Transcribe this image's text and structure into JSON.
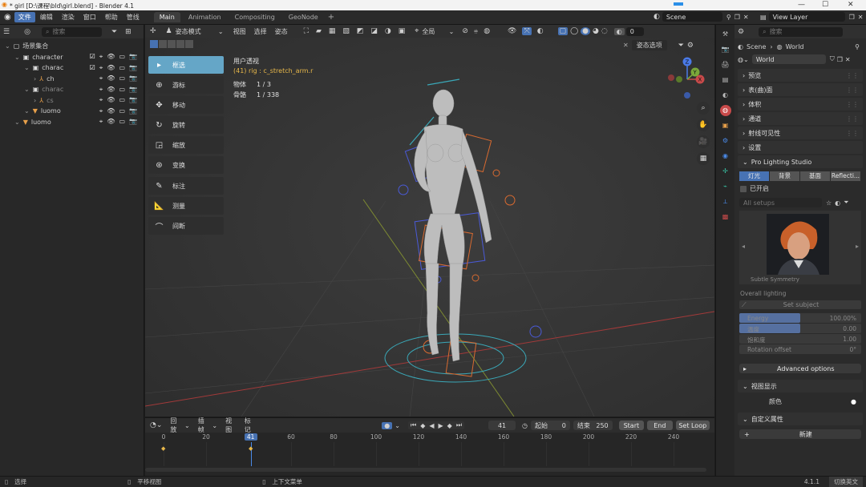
{
  "window": {
    "title": "* girl [D:\\课程\\bld\\girl.blend] - Blender 4.1",
    "min": "—",
    "max": "☐",
    "close": "✕"
  },
  "menu": [
    "文件",
    "编辑",
    "渲染",
    "窗口",
    "帮助",
    "管线"
  ],
  "workspaces": [
    "Main",
    "Animation",
    "Compositing",
    "GeoNode"
  ],
  "workspace_add": "+",
  "scene": {
    "label": "Scene",
    "view_layer": "View Layer"
  },
  "outliner": {
    "search_placeholder": "搜索",
    "rows": [
      {
        "label": "场景集合",
        "indent": 0
      },
      {
        "label": "character",
        "indent": 1
      },
      {
        "label": "charac",
        "indent": 2
      },
      {
        "label": "ch",
        "indent": 3
      },
      {
        "label": "charac",
        "indent": 2
      },
      {
        "label": "cs",
        "indent": 3
      },
      {
        "label": "luomo",
        "indent": 2
      },
      {
        "label": "luomo",
        "indent": 1
      }
    ]
  },
  "viewport_header": {
    "mode": "姿态模式",
    "menus": [
      "视图",
      "选择",
      "姿态"
    ],
    "transform": "全局",
    "overlay_count": "0",
    "pose_options": "姿态选项"
  },
  "overlay_text": {
    "view": "用户透视",
    "context": "(41) rig : c_stretch_arm.r",
    "objects_label": "物体",
    "objects_value": "1 / 3",
    "bones_label": "骨骼",
    "bones_value": "1 / 338"
  },
  "tools": [
    {
      "label": "框选",
      "icon": "▸"
    },
    {
      "label": "游标",
      "icon": "⊕"
    },
    {
      "label": "移动",
      "icon": "✥"
    },
    {
      "label": "旋转",
      "icon": "↻"
    },
    {
      "label": "缩放",
      "icon": "◲"
    },
    {
      "label": "变换",
      "icon": "⊛"
    },
    {
      "label": "标注",
      "icon": "✎"
    },
    {
      "label": "测量",
      "icon": "📐"
    },
    {
      "label": "间断",
      "icon": "⌒"
    }
  ],
  "gizmo_axes": {
    "x": "X",
    "y": "Y",
    "z": "Z"
  },
  "properties": {
    "scene_crumb": "Scene",
    "world_crumb": "World",
    "world_name": "World",
    "sections": [
      "预览",
      "表(曲)面",
      "体积",
      "通道",
      "射线可见性",
      "设置"
    ],
    "plugin_title": "Pro Lighting Studio",
    "tabs": [
      "灯光",
      "背景",
      "基面",
      "Reflecti..."
    ],
    "enabled": "已开启",
    "setups_placeholder": "All setups",
    "preview_caption": "Subtle Symmetry",
    "overall": "Overall lighting",
    "set_subject": "Set subject",
    "sliders": [
      {
        "label": "Energy",
        "value": "100.00%",
        "fill": 0.5
      },
      {
        "label": "温度",
        "value": "0.00",
        "fill": 0.5
      },
      {
        "label": "饱和度",
        "value": "1.00",
        "fill": 0
      },
      {
        "label": "Rotation offset",
        "value": "0°",
        "fill": 0
      }
    ],
    "advanced": "Advanced options",
    "viewport_display": "视图显示",
    "color_label": "颜色",
    "custom_props": "自定义属性",
    "new_button": "新建"
  },
  "timeline": {
    "menus": [
      "回放",
      "插帧",
      "视图",
      "标记"
    ],
    "current_frame": "41",
    "start_label": "起始",
    "start": "0",
    "end_label": "结束",
    "end": "250",
    "start_btn": "Start",
    "end_btn": "End",
    "set_loop": "Set Loop",
    "ticks": [
      "0",
      "20",
      "41",
      "60",
      "80",
      "100",
      "120",
      "140",
      "160",
      "180",
      "200",
      "220",
      "240"
    ],
    "tick_frames": [
      0,
      20,
      41,
      60,
      80,
      100,
      120,
      140,
      160,
      180,
      200,
      220,
      240
    ]
  },
  "status": {
    "select": "选择",
    "pan": "平移视图",
    "context_menu": "上下文菜单",
    "version": "4.1.1",
    "ime": "切换英文"
  }
}
